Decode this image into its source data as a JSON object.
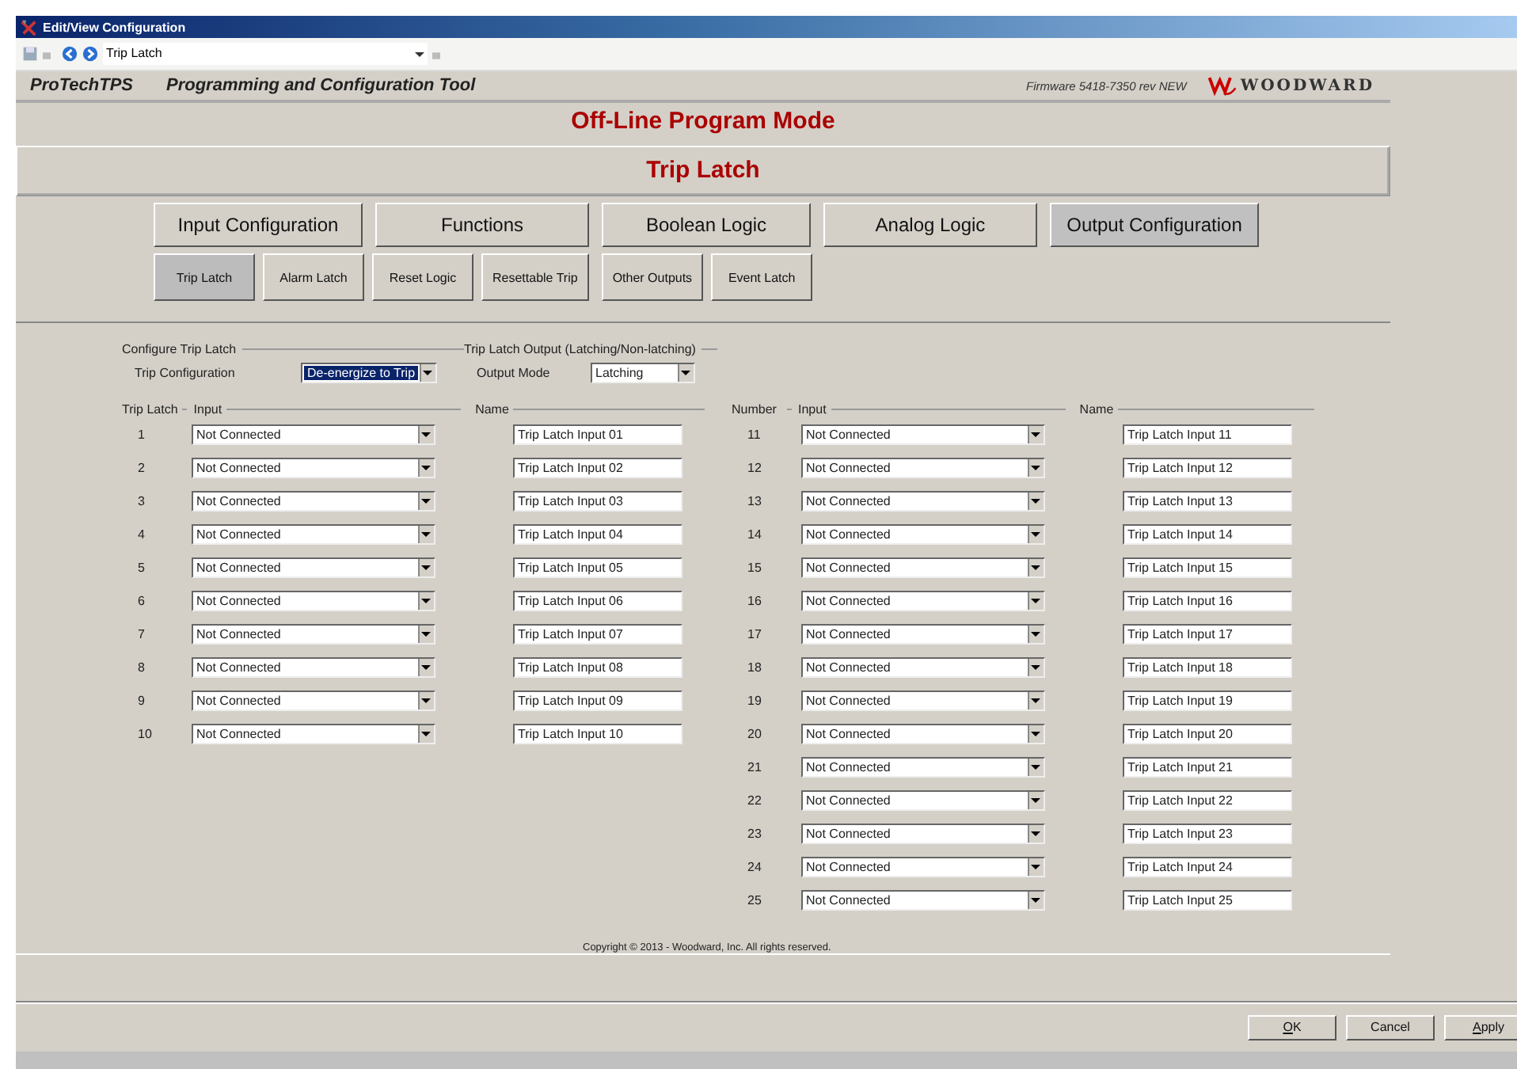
{
  "window": {
    "title": "Edit/View Configuration"
  },
  "toolbar": {
    "page_select": "Trip Latch"
  },
  "header": {
    "product": "ProTechTPS",
    "tool": "Programming and Configuration Tool",
    "firmware": "Firmware 5418-7350 rev NEW",
    "brand": "WOODWARD"
  },
  "mode": "Off-Line Program Mode",
  "page_title": "Trip Latch",
  "main_tabs": [
    {
      "label": "Input Configuration",
      "selected": false
    },
    {
      "label": "Functions",
      "selected": false
    },
    {
      "label": "Boolean Logic",
      "selected": false
    },
    {
      "label": "Analog Logic",
      "selected": false
    },
    {
      "label": "Output Configuration",
      "selected": true
    }
  ],
  "sub_tabs": [
    {
      "label": "Trip Latch",
      "selected": true
    },
    {
      "label": "Alarm Latch",
      "selected": false
    },
    {
      "label": "Reset Logic",
      "selected": false
    },
    {
      "label": "Resettable Trip",
      "selected": false
    },
    {
      "label": "Other Outputs",
      "selected": false
    },
    {
      "label": "Event Latch",
      "selected": false
    }
  ],
  "configure": {
    "legend": "Configure Trip Latch",
    "label": "Trip Configuration",
    "value": "De-energize to Trip",
    "focused": true
  },
  "output": {
    "legend": "Trip Latch Output (Latching/Non-latching)",
    "label": "Output Mode",
    "value": "Latching"
  },
  "left_columns": {
    "number": "Trip Latch",
    "input": "Input",
    "name": "Name"
  },
  "right_columns": {
    "number": "Number",
    "input": "Input",
    "name": "Name"
  },
  "left_rows": [
    {
      "number": "1",
      "input": "Not Connected",
      "name": "Trip Latch Input 01"
    },
    {
      "number": "2",
      "input": "Not Connected",
      "name": "Trip Latch Input 02"
    },
    {
      "number": "3",
      "input": "Not Connected",
      "name": "Trip Latch Input 03"
    },
    {
      "number": "4",
      "input": "Not Connected",
      "name": "Trip Latch Input 04"
    },
    {
      "number": "5",
      "input": "Not Connected",
      "name": "Trip Latch Input 05"
    },
    {
      "number": "6",
      "input": "Not Connected",
      "name": "Trip Latch Input 06"
    },
    {
      "number": "7",
      "input": "Not Connected",
      "name": "Trip Latch Input 07"
    },
    {
      "number": "8",
      "input": "Not Connected",
      "name": "Trip Latch Input 08"
    },
    {
      "number": "9",
      "input": "Not Connected",
      "name": "Trip Latch Input 09"
    },
    {
      "number": "10",
      "input": "Not Connected",
      "name": "Trip Latch Input 10"
    }
  ],
  "right_rows": [
    {
      "number": "11",
      "input": "Not Connected",
      "name": "Trip Latch Input 11"
    },
    {
      "number": "12",
      "input": "Not Connected",
      "name": "Trip Latch Input 12"
    },
    {
      "number": "13",
      "input": "Not Connected",
      "name": "Trip Latch Input 13"
    },
    {
      "number": "14",
      "input": "Not Connected",
      "name": "Trip Latch Input 14"
    },
    {
      "number": "15",
      "input": "Not Connected",
      "name": "Trip Latch Input 15"
    },
    {
      "number": "16",
      "input": "Not Connected",
      "name": "Trip Latch Input 16"
    },
    {
      "number": "17",
      "input": "Not Connected",
      "name": "Trip Latch Input 17"
    },
    {
      "number": "18",
      "input": "Not Connected",
      "name": "Trip Latch Input 18"
    },
    {
      "number": "19",
      "input": "Not Connected",
      "name": "Trip Latch Input 19"
    },
    {
      "number": "20",
      "input": "Not Connected",
      "name": "Trip Latch Input 20"
    },
    {
      "number": "21",
      "input": "Not Connected",
      "name": "Trip Latch Input 21"
    },
    {
      "number": "22",
      "input": "Not Connected",
      "name": "Trip Latch Input 22"
    },
    {
      "number": "23",
      "input": "Not Connected",
      "name": "Trip Latch Input 23"
    },
    {
      "number": "24",
      "input": "Not Connected",
      "name": "Trip Latch Input 24"
    },
    {
      "number": "25",
      "input": "Not Connected",
      "name": "Trip Latch Input 25"
    }
  ],
  "copyright": "Copyright © 2013 - Woodward, Inc. All rights reserved.",
  "buttons": [
    {
      "label": "OK",
      "access_key_underlined": true
    },
    {
      "label": "Cancel",
      "access_key_underlined": false
    },
    {
      "label": "Apply",
      "access_key_underlined": true
    }
  ]
}
